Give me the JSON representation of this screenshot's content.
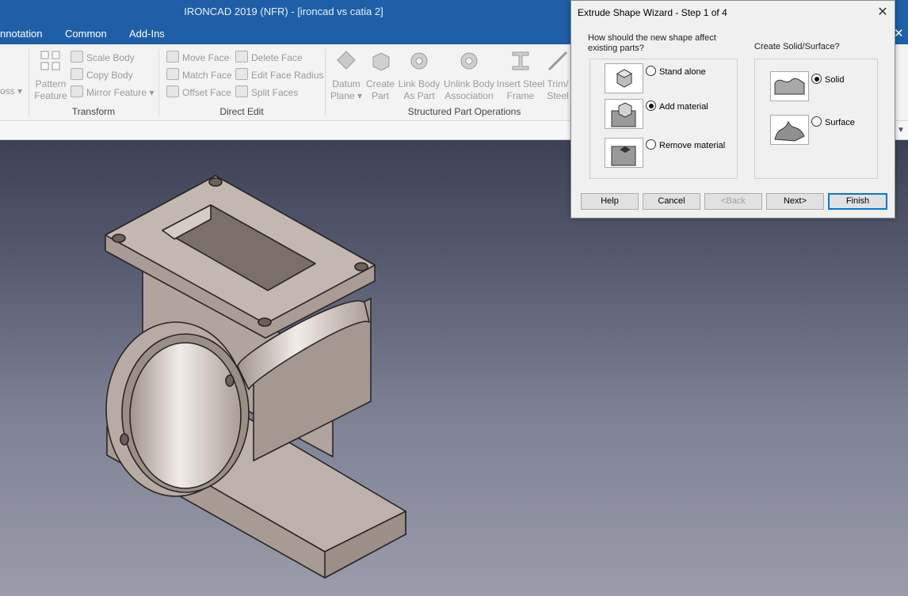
{
  "window": {
    "title": "IRONCAD 2019 (NFR) - [ironcad vs catia 2]"
  },
  "ribbon_tabs": [
    "nnotation",
    "Common",
    "Add-Ins"
  ],
  "ribbon": {
    "partial_left_label": "oss",
    "groups": {
      "transform": "Transform",
      "direct_edit": "Direct Edit",
      "structured": "Structured Part Operations"
    },
    "pattern_feature": [
      "Pattern",
      "Feature"
    ],
    "scale_body": "Scale Body",
    "copy_body": "Copy Body",
    "mirror_feature": "Mirror Feature",
    "move_face": "Move Face",
    "match_face": "Match Face",
    "offset_face": "Offset Face",
    "delete_face": "Delete Face",
    "edit_face_radius": "Edit Face Radius",
    "split_faces": "Split Faces",
    "datum_plane": [
      "Datum",
      "Plane"
    ],
    "create_part": [
      "Create",
      "Part"
    ],
    "link_body": [
      "Link Body",
      "As Part"
    ],
    "unlink_body": [
      "Unlink Body",
      "Association"
    ],
    "insert_steel_frame": [
      "Insert Steel",
      "Frame"
    ],
    "trim_steel": [
      "Trim/",
      "Steel"
    ]
  },
  "dialog": {
    "title": "Extrude Shape Wizard - Step 1 of 4",
    "question_parts": "How should the new shape affect existing parts?",
    "question_solid": "Create Solid/Surface?",
    "part_options": [
      {
        "label": "Stand alone",
        "selected": false
      },
      {
        "label": "Add material",
        "selected": true
      },
      {
        "label": "Remove material",
        "selected": false
      }
    ],
    "solid_options": [
      {
        "label": "Solid",
        "selected": true
      },
      {
        "label": "Surface",
        "selected": false
      }
    ],
    "buttons": {
      "help": "Help",
      "cancel": "Cancel",
      "back": "<Back",
      "next": "Next>",
      "finish": "Finish"
    }
  },
  "colors": {
    "title_bar": "#1f5fa8",
    "part": "#b8ada6",
    "accent": "#0078d7"
  }
}
